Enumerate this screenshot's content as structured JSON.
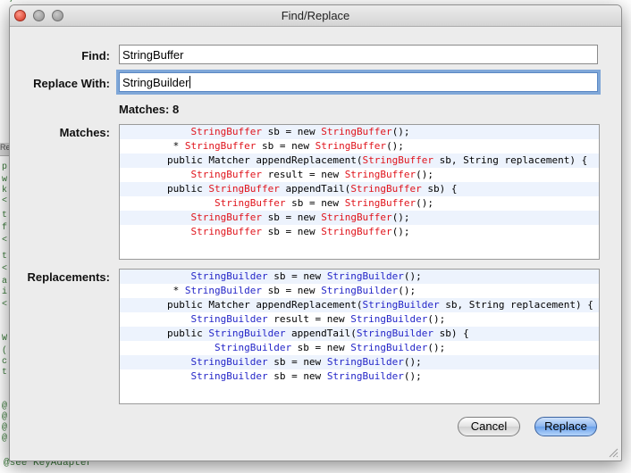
{
  "dialog": {
    "title": "Find/Replace",
    "find_label": "Find:",
    "find_value": "StringBuffer",
    "replace_label": "Replace With:",
    "replace_value": "StringBuilder",
    "matches_count": "Matches: 8",
    "matches_label": "Matches:",
    "replacements_label": "Replacements:",
    "cancel_label": "Cancel",
    "replace_button_label": "Replace"
  },
  "matches": [
    {
      "indent": "      ",
      "parts": [
        [
          "StringBuffer",
          "r"
        ],
        [
          " sb = new ",
          ""
        ],
        [
          "StringBuffer",
          "r"
        ],
        [
          "();",
          ""
        ]
      ]
    },
    {
      "indent": "   * ",
      "parts": [
        [
          "StringBuffer",
          "r"
        ],
        [
          " sb = new ",
          ""
        ],
        [
          "StringBuffer",
          "r"
        ],
        [
          "();",
          ""
        ]
      ]
    },
    {
      "indent": "  ",
      "parts": [
        [
          "public Matcher appendReplacement(",
          ""
        ],
        [
          "StringBuffer",
          "r"
        ],
        [
          " sb, String replacement) {",
          ""
        ]
      ]
    },
    {
      "indent": "      ",
      "parts": [
        [
          "StringBuffer",
          "r"
        ],
        [
          " result = new ",
          ""
        ],
        [
          "StringBuffer",
          "r"
        ],
        [
          "();",
          ""
        ]
      ]
    },
    {
      "indent": "  ",
      "parts": [
        [
          "public ",
          ""
        ],
        [
          "StringBuffer",
          "r"
        ],
        [
          " appendTail(",
          ""
        ],
        [
          "StringBuffer",
          "r"
        ],
        [
          " sb) {",
          ""
        ]
      ]
    },
    {
      "indent": "          ",
      "parts": [
        [
          "StringBuffer",
          "r"
        ],
        [
          " sb = new ",
          ""
        ],
        [
          "StringBuffer",
          "r"
        ],
        [
          "();",
          ""
        ]
      ]
    },
    {
      "indent": "      ",
      "parts": [
        [
          "StringBuffer",
          "r"
        ],
        [
          " sb = new ",
          ""
        ],
        [
          "StringBuffer",
          "r"
        ],
        [
          "();",
          ""
        ]
      ]
    },
    {
      "indent": "      ",
      "parts": [
        [
          "StringBuffer",
          "r"
        ],
        [
          " sb = new ",
          ""
        ],
        [
          "StringBuffer",
          "r"
        ],
        [
          "();",
          ""
        ]
      ]
    }
  ],
  "replacements": [
    {
      "indent": "      ",
      "parts": [
        [
          "StringBuilder",
          "b"
        ],
        [
          " sb = new ",
          ""
        ],
        [
          "StringBuilder",
          "b"
        ],
        [
          "();",
          ""
        ]
      ]
    },
    {
      "indent": "   * ",
      "parts": [
        [
          "StringBuilder",
          "b"
        ],
        [
          " sb = new ",
          ""
        ],
        [
          "StringBuilder",
          "b"
        ],
        [
          "();",
          ""
        ]
      ]
    },
    {
      "indent": "  ",
      "parts": [
        [
          "public Matcher appendReplacement(",
          ""
        ],
        [
          "StringBuilder",
          "b"
        ],
        [
          " sb, String replacement) {",
          ""
        ]
      ]
    },
    {
      "indent": "      ",
      "parts": [
        [
          "StringBuilder",
          "b"
        ],
        [
          " result = new ",
          ""
        ],
        [
          "StringBuilder",
          "b"
        ],
        [
          "();",
          ""
        ]
      ]
    },
    {
      "indent": "  ",
      "parts": [
        [
          "public ",
          ""
        ],
        [
          "StringBuilder",
          "b"
        ],
        [
          " appendTail(",
          ""
        ],
        [
          "StringBuilder",
          "b"
        ],
        [
          " sb) {",
          ""
        ]
      ]
    },
    {
      "indent": "          ",
      "parts": [
        [
          "StringBuilder",
          "b"
        ],
        [
          " sb = new ",
          ""
        ],
        [
          "StringBuilder",
          "b"
        ],
        [
          "();",
          ""
        ]
      ]
    },
    {
      "indent": "      ",
      "parts": [
        [
          "StringBuilder",
          "b"
        ],
        [
          " sb = new ",
          ""
        ],
        [
          "StringBuilder",
          "b"
        ],
        [
          "();",
          ""
        ]
      ]
    },
    {
      "indent": "      ",
      "parts": [
        [
          "StringBuilder",
          "b"
        ],
        [
          " sb = new ",
          ""
        ],
        [
          "StringBuilder",
          "b"
        ],
        [
          "();",
          ""
        ]
      ]
    }
  ],
  "background_editor": {
    "top_comment": "*/",
    "gutter_tab": "Re",
    "gutter_chars": [
      "p",
      "w",
      "k",
      "<",
      "t",
      "f",
      "<",
      "t",
      "<",
      "a",
      "i",
      "<",
      "W",
      "(",
      "c",
      "t",
      "@",
      "@",
      "@",
      "@"
    ],
    "bottom_text": "@see KeyAdapter"
  },
  "colors": {
    "match_highlight": "#e0141c",
    "replacement_highlight": "#2426c8",
    "alt_row": "#edf3fd"
  }
}
